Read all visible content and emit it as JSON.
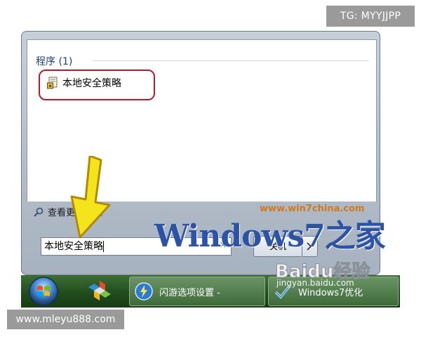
{
  "corner_tag": "TG: MYYJJPP",
  "site_tag": "www.mleyu888.com",
  "start_menu": {
    "section_title": "程序 (1)",
    "result_label": "本地安全策略",
    "see_more_label": "查看更多结果",
    "search_value": "本地安全策略",
    "clear_symbol": "×",
    "shutdown_label": "关机"
  },
  "taskbar": {
    "task_items": [
      {
        "label": "闪游选项设置 -"
      },
      {
        "label": "Windows7优化"
      }
    ]
  },
  "watermarks": {
    "url": "www.win7china.com",
    "logo": "Windows7之家",
    "baidu": "Baidu经验",
    "jingyan": "jingyan.baidu.com"
  },
  "colors": {
    "highlight_outline": "#c0182b",
    "arrow_fill": "#f4e41c",
    "taskbar": "#2b5a27"
  }
}
